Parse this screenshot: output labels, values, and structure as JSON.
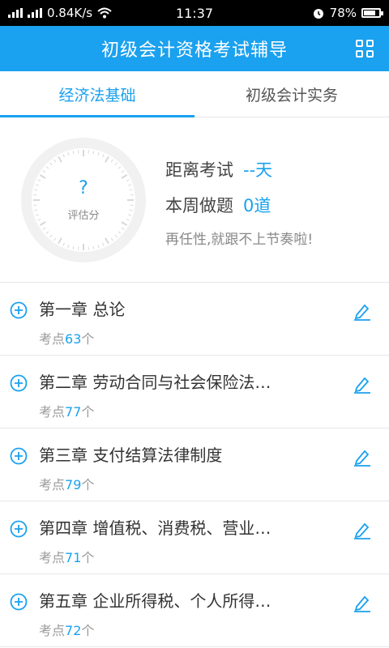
{
  "status_bar": {
    "network_speed": "0.84K/s",
    "time": "11:37",
    "battery": "78%",
    "battery_level": 0.78,
    "icons": [
      "signal-icon",
      "signal-icon",
      "wifi-icon",
      "alarm-icon",
      "battery-icon"
    ]
  },
  "app_bar": {
    "title": "初级会计资格考试辅导",
    "menu_icon": "grid-icon"
  },
  "tabs": [
    {
      "label": "经济法基础",
      "active": true
    },
    {
      "label": "初级会计实务",
      "active": false
    }
  ],
  "summary": {
    "score_symbol": "?",
    "score_label": "评估分",
    "days_label": "距离考试",
    "days_value": "--天",
    "week_label": "本周做题",
    "week_value": "0道",
    "motto": "再任性,就跟不上节奏啦!"
  },
  "chapters": [
    {
      "title": "第一章 总论",
      "points_prefix": "考点",
      "points": "63",
      "points_suffix": "个"
    },
    {
      "title": "第二章 劳动合同与社会保险法…",
      "points_prefix": "考点",
      "points": "77",
      "points_suffix": "个"
    },
    {
      "title": "第三章 支付结算法律制度",
      "points_prefix": "考点",
      "points": "79",
      "points_suffix": "个"
    },
    {
      "title": "第四章 增值税、消费税、营业…",
      "points_prefix": "考点",
      "points": "71",
      "points_suffix": "个"
    },
    {
      "title": "第五章 企业所得税、个人所得…",
      "points_prefix": "考点",
      "points": "72",
      "points_suffix": "个"
    }
  ],
  "colors": {
    "accent": "#1aa1ef",
    "divider": "#e6e6e6"
  }
}
